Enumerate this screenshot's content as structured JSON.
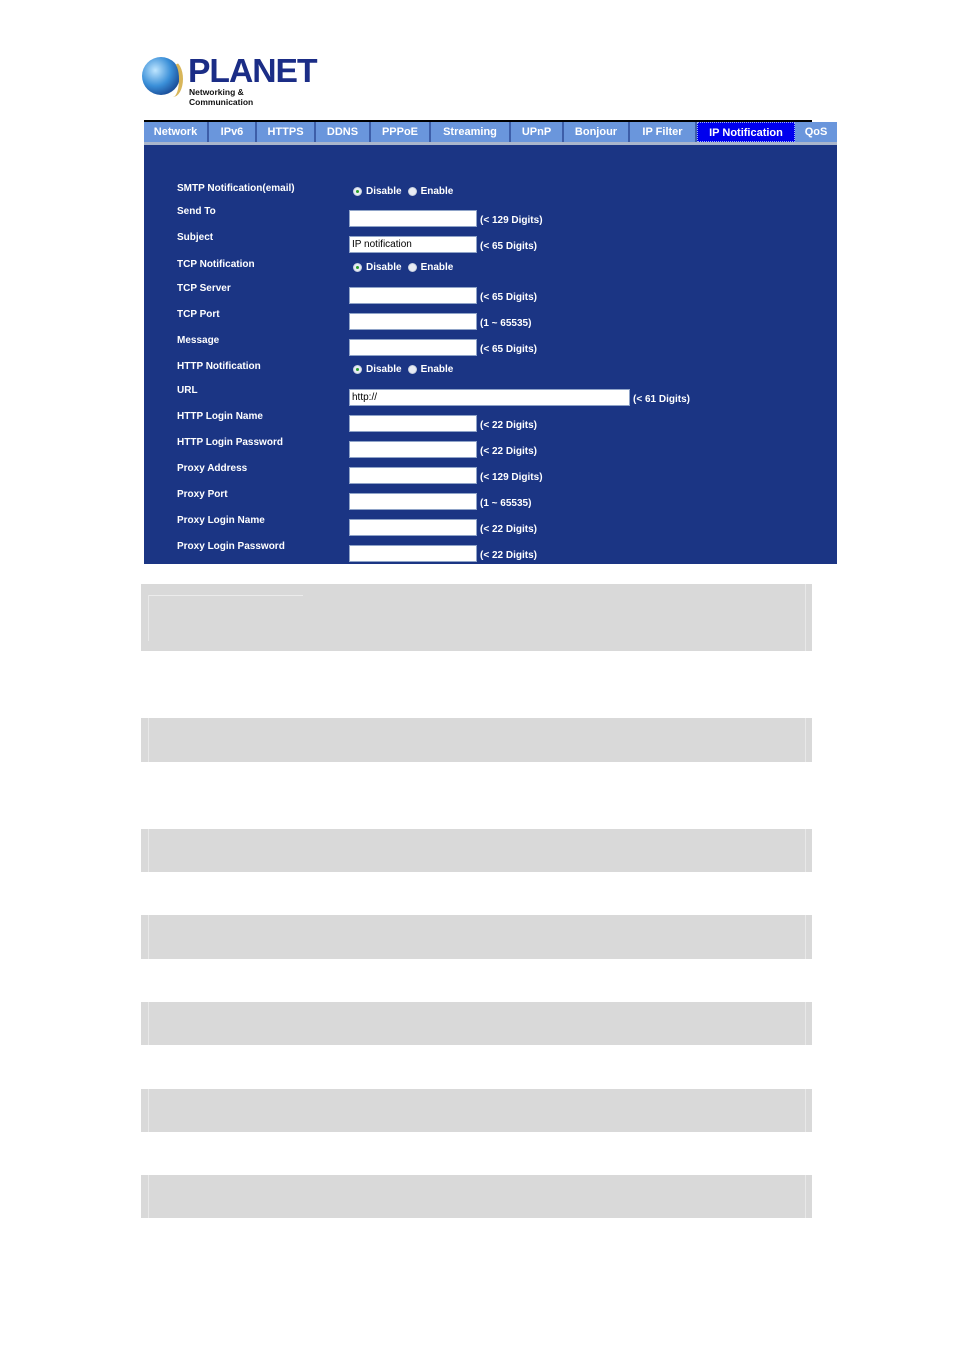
{
  "brand": {
    "name": "PLANET",
    "tagline": "Networking & Communication",
    "colors": {
      "wordmark": "#1b2d86",
      "panel": "#1b3584",
      "tab": "#6a96dc",
      "active_tab": "#0000ee",
      "block": "#d9d9d9"
    }
  },
  "tabs": [
    {
      "label": "Network",
      "active": false
    },
    {
      "label": "IPv6",
      "active": false
    },
    {
      "label": "HTTPS",
      "active": false
    },
    {
      "label": "DDNS",
      "active": false
    },
    {
      "label": "PPPoE",
      "active": false
    },
    {
      "label": "Streaming",
      "active": false
    },
    {
      "label": "UPnP",
      "active": false
    },
    {
      "label": "Bonjour",
      "active": false
    },
    {
      "label": "IP Filter",
      "active": false
    },
    {
      "label": "IP Notification",
      "active": true
    },
    {
      "label": "QoS",
      "active": false
    }
  ],
  "form": {
    "smtp_notification": {
      "label": "SMTP Notification(email)",
      "options": [
        "Disable",
        "Enable"
      ],
      "selected": "Disable"
    },
    "send_to": {
      "label": "Send To",
      "value": "",
      "hint": "(< 129 Digits)"
    },
    "subject": {
      "label": "Subject",
      "value": "IP notification",
      "hint": "(< 65 Digits)"
    },
    "tcp_notification": {
      "label": "TCP Notification",
      "options": [
        "Disable",
        "Enable"
      ],
      "selected": "Disable"
    },
    "tcp_server": {
      "label": "TCP Server",
      "value": "",
      "hint": "(< 65 Digits)"
    },
    "tcp_port": {
      "label": "TCP Port",
      "value": "",
      "hint": "(1 ~ 65535)"
    },
    "message": {
      "label": "Message",
      "value": "",
      "hint": "(< 65 Digits)"
    },
    "http_notification": {
      "label": "HTTP Notification",
      "options": [
        "Disable",
        "Enable"
      ],
      "selected": "Disable"
    },
    "url": {
      "label": "URL",
      "value": "http://",
      "hint": "(< 61 Digits)"
    },
    "http_login_name": {
      "label": "HTTP Login Name",
      "value": "",
      "hint": "(< 22 Digits)"
    },
    "http_login_password": {
      "label": "HTTP Login Password",
      "value": "",
      "hint": "(< 22 Digits)"
    },
    "proxy_address": {
      "label": "Proxy Address",
      "value": "",
      "hint": "(< 129 Digits)"
    },
    "proxy_port": {
      "label": "Proxy Port",
      "value": "",
      "hint": "(1 ~ 65535)"
    },
    "proxy_login_name": {
      "label": "Proxy Login Name",
      "value": "",
      "hint": "(< 22 Digits)"
    },
    "proxy_login_password": {
      "label": "Proxy Login Password",
      "value": "",
      "hint": "(< 22 Digits)"
    }
  }
}
